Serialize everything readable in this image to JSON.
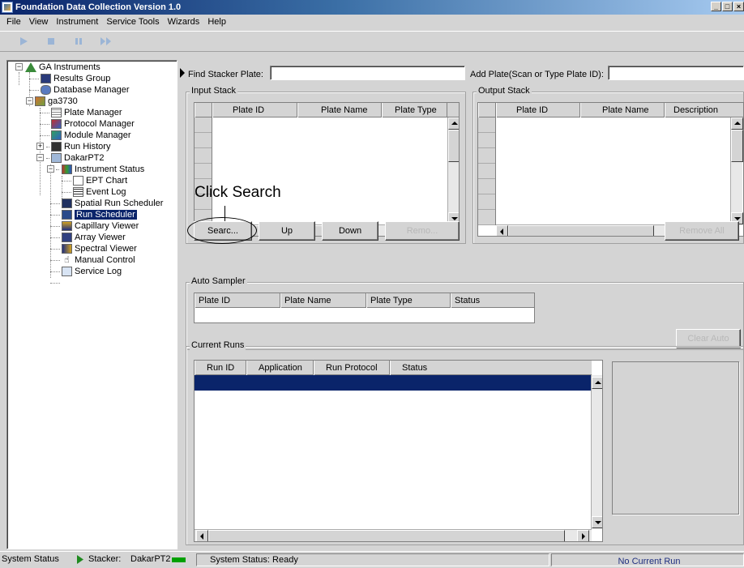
{
  "window": {
    "title": "Foundation Data Collection Version 1.0",
    "controls": [
      "_",
      "□",
      "×"
    ]
  },
  "menu": {
    "items": [
      "File",
      "View",
      "Instrument",
      "Service Tools",
      "Wizards",
      "Help"
    ]
  },
  "toolbar": {
    "icons": [
      "play-icon",
      "stop-icon",
      "pause-icon",
      "skip-icon"
    ]
  },
  "tree": {
    "items": [
      {
        "label": "GA Instruments",
        "icon": "instrument-icon"
      },
      {
        "label": "Results Group",
        "icon": "results-group-icon"
      },
      {
        "label": "Database Manager",
        "icon": "database-icon"
      },
      {
        "label": "ga3730",
        "icon": "instrument-node-icon"
      },
      {
        "label": "Plate Manager",
        "icon": "plate-icon"
      },
      {
        "label": "Protocol Manager",
        "icon": "protocol-icon"
      },
      {
        "label": "Module Manager",
        "icon": "module-icon"
      },
      {
        "label": "Run History",
        "icon": "history-icon"
      },
      {
        "label": "DakarPT2",
        "icon": "computer-icon"
      },
      {
        "label": "Instrument Status",
        "icon": "status-icon"
      },
      {
        "label": "EPT Chart",
        "icon": "chart-icon"
      },
      {
        "label": "Event Log",
        "icon": "log-icon"
      },
      {
        "label": "Spatial Run Scheduler",
        "icon": "spatial-icon"
      },
      {
        "label": "Run Scheduler",
        "icon": "scheduler-icon"
      },
      {
        "label": "Capillary Viewer",
        "icon": "capillary-icon"
      },
      {
        "label": "Array Viewer",
        "icon": "array-icon"
      },
      {
        "label": "Spectral Viewer",
        "icon": "spectral-icon"
      },
      {
        "label": "Manual Control",
        "icon": "hand-icon"
      },
      {
        "label": "Service Log",
        "icon": "service-log-icon"
      }
    ]
  },
  "find": {
    "label": "Find Stacker Plate:",
    "value": ""
  },
  "add_plate": {
    "label": "Add Plate(Scan or Type Plate ID):",
    "value": ""
  },
  "input_stack": {
    "title": "Input Stack",
    "columns": [
      "Plate ID",
      "Plate Name",
      "Plate Type"
    ]
  },
  "output_stack": {
    "title": "Output Stack",
    "columns": [
      "Plate ID",
      "Plate Name",
      "Description"
    ]
  },
  "input_buttons": {
    "search": "Searc...",
    "up": "Up",
    "down": "Down",
    "remove": "Remo..."
  },
  "output_buttons": {
    "remove_all": "Remove All"
  },
  "annotation": {
    "text": "Click Search"
  },
  "auto_sampler": {
    "title": "Auto Sampler",
    "columns": [
      "Plate ID",
      "Plate Name",
      "Plate Type",
      "Status"
    ],
    "clear_button": "Clear Auto"
  },
  "current_runs": {
    "title": "Current Runs",
    "columns": [
      "Run ID",
      "Application",
      "Run Protocol",
      "Status"
    ]
  },
  "status_bar": {
    "system_status_label": "System Status",
    "stacker_label": "Stacker:",
    "stacker_value": "DakarPT2",
    "status_text": "System Status: Ready",
    "current_run": "No Current Run"
  },
  "colors": {
    "selection": "#0a246a",
    "ok_indicator": "#00a000"
  }
}
